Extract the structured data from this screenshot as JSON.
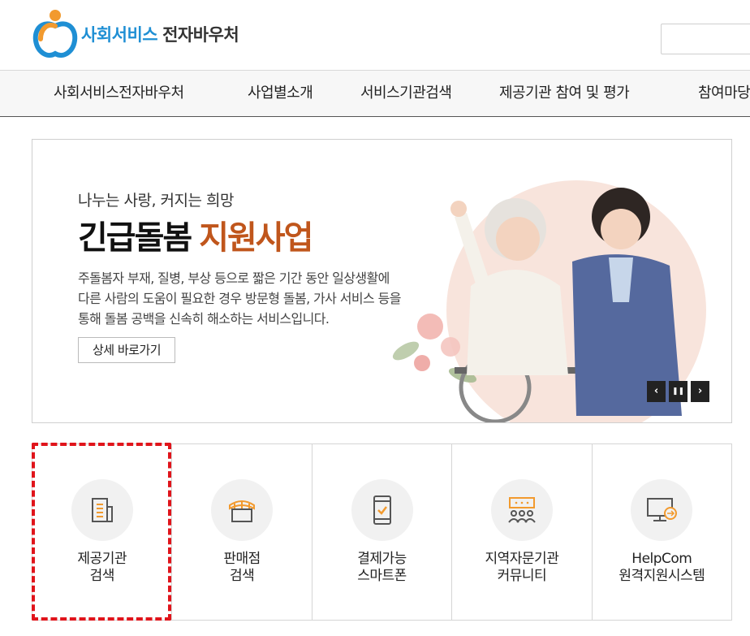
{
  "header": {
    "logo_brand": "사회서비스",
    "logo_suffix": "전자바우처",
    "search_placeholder": ""
  },
  "gnb": {
    "items": [
      {
        "label": "사회서비스전자바우처"
      },
      {
        "label": "사업별소개"
      },
      {
        "label": "서비스기관검색"
      },
      {
        "label": "제공기관 참여 및 평가"
      },
      {
        "label": "참여마당"
      }
    ]
  },
  "banner": {
    "subtitle": "나누는 사랑, 커지는 희망",
    "title_main": "긴급돌봄",
    "title_accent": "지원사업",
    "desc_lines": [
      "주돌봄자 부재, 질병, 부상 등으로 짧은 기간 동안 일상생활에",
      "다른 사람의 도움이 필요한 경우 방문형 돌봄, 가사 서비스 등을",
      "통해 돌봄 공백을 신속히 해소하는 서비스입니다."
    ],
    "more_label": "상세 바로가기",
    "prev_label": "‹",
    "pause_label": "❚❚",
    "next_label": "›"
  },
  "quick_menu": [
    {
      "line1": "제공기관",
      "line2": "검색",
      "icon": "building-document-icon"
    },
    {
      "line1": "판매점",
      "line2": "검색",
      "icon": "store-icon"
    },
    {
      "line1": "결제가능",
      "line2": "스마트폰",
      "icon": "smartphone-check-icon"
    },
    {
      "line1": "지역자문기관",
      "line2": "커뮤니티",
      "icon": "community-board-icon"
    },
    {
      "line1": "HelpCom",
      "line2": "원격지원시스템",
      "icon": "remote-monitor-icon"
    }
  ],
  "colors": {
    "brand_blue": "#1f8fd4",
    "accent_orange": "#c0561c",
    "icon_orange": "#f29a2e",
    "highlight_red": "#e0141b"
  }
}
